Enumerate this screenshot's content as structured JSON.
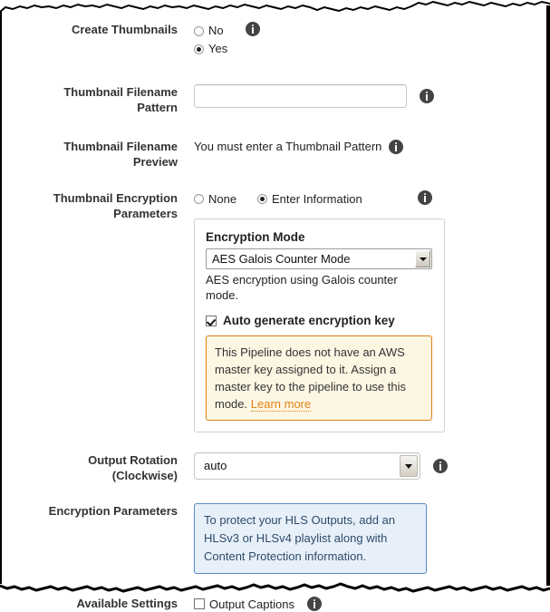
{
  "form": {
    "rows": [
      {
        "label": "Create Thumbnails",
        "type": "radio-stack",
        "options": [
          {
            "label": "No",
            "selected": false
          },
          {
            "label": "Yes",
            "selected": true
          }
        ],
        "info_icon": "info-icon"
      },
      {
        "label": "Thumbnail Filename Pattern",
        "type": "text-input",
        "value": "",
        "placeholder": "",
        "info_icon": "info-icon"
      },
      {
        "label": "Thumbnail Filename Preview",
        "type": "static",
        "text": "You must enter a Thumbnail Pattern",
        "info_icon": "info-icon"
      },
      {
        "label": "Thumbnail Encryption Parameters",
        "type": "radio-inline-panel",
        "options": [
          {
            "label": "None",
            "selected": false
          },
          {
            "label": "Enter Information",
            "selected": true
          }
        ],
        "info_icon": "info-icon",
        "panel": {
          "title": "Encryption Mode",
          "select": {
            "value": "AES Galois Counter Mode",
            "options": [
              "AES Galois Counter Mode"
            ]
          },
          "help_text": "AES encryption using Galois counter mode.",
          "checkbox": {
            "label": "Auto generate encryption key",
            "checked": true
          },
          "warning": {
            "text": "This Pipeline does not have an AWS master key assigned to it. Assign a master key to the pipeline to use this mode.",
            "link_label": "Learn more",
            "border_color": "#e08214",
            "background_color": "#fdf6e3",
            "link_color": "#e08214"
          }
        }
      },
      {
        "label": "Output Rotation (Clockwise)",
        "type": "select",
        "select": {
          "value": "auto",
          "options": [
            "auto"
          ]
        },
        "info_icon": "info-icon"
      },
      {
        "label": "Encryption Parameters",
        "type": "blue-box",
        "blue_box": {
          "text": "To protect your HLS Outputs, add an HLSv3 or HLSv4 playlist along with Content Protection information.",
          "border_color": "#5a8ac6",
          "background_color": "#e7f0f9",
          "text_color": "#2e4b6b"
        }
      },
      {
        "label": "Available Settings",
        "type": "checkbox",
        "checkbox": {
          "label": "Output Captions",
          "checked": false
        },
        "info_icon": "info-icon"
      }
    ]
  },
  "labels": {
    "create_thumbnails": "Create Thumbnails",
    "thumbnail_filename_pattern_l1": "Thumbnail Filename",
    "thumbnail_filename_pattern_l2": "Pattern",
    "thumbnail_filename_preview_l1": "Thumbnail Filename",
    "thumbnail_filename_preview_l2": "Preview",
    "thumbnail_encryption_l1": "Thumbnail Encryption",
    "thumbnail_encryption_l2": "Parameters",
    "output_rotation_l1": "Output Rotation",
    "output_rotation_l2": "(Clockwise)",
    "encryption_parameters": "Encryption Parameters",
    "available_settings": "Available Settings"
  },
  "values": {
    "radio_no": "No",
    "radio_yes": "Yes",
    "thumbnail_pattern_value": "",
    "thumbnail_preview_text": "You must enter a Thumbnail Pattern",
    "radio_none": "None",
    "radio_enter_information": "Enter Information",
    "encryption_mode_title": "Encryption Mode",
    "encryption_mode_value": "AES Galois Counter Mode",
    "encryption_mode_help": "AES encryption using Galois counter mode.",
    "auto_generate_key_label": "Auto generate encryption key",
    "warning_text": "This Pipeline does not have an AWS master key assigned to it. Assign a master key to the pipeline to use this mode.",
    "warning_link": "Learn more",
    "output_rotation_value": "auto",
    "encryption_blue_text": "To protect your HLS Outputs, add an HLSv3 or HLSv4 playlist along with Content Protection information.",
    "output_captions_label": "Output Captions"
  },
  "colors": {
    "label_text": "#333333",
    "body_text": "#222222",
    "info_icon_bg": "#444444",
    "warning_border": "#e08214",
    "warning_bg": "#fdf6e3",
    "link_orange": "#e08214",
    "blue_border": "#5a8ac6",
    "blue_bg": "#e7f0f9",
    "blue_text": "#2e4b6b",
    "panel_border": "#cfcfcf"
  }
}
